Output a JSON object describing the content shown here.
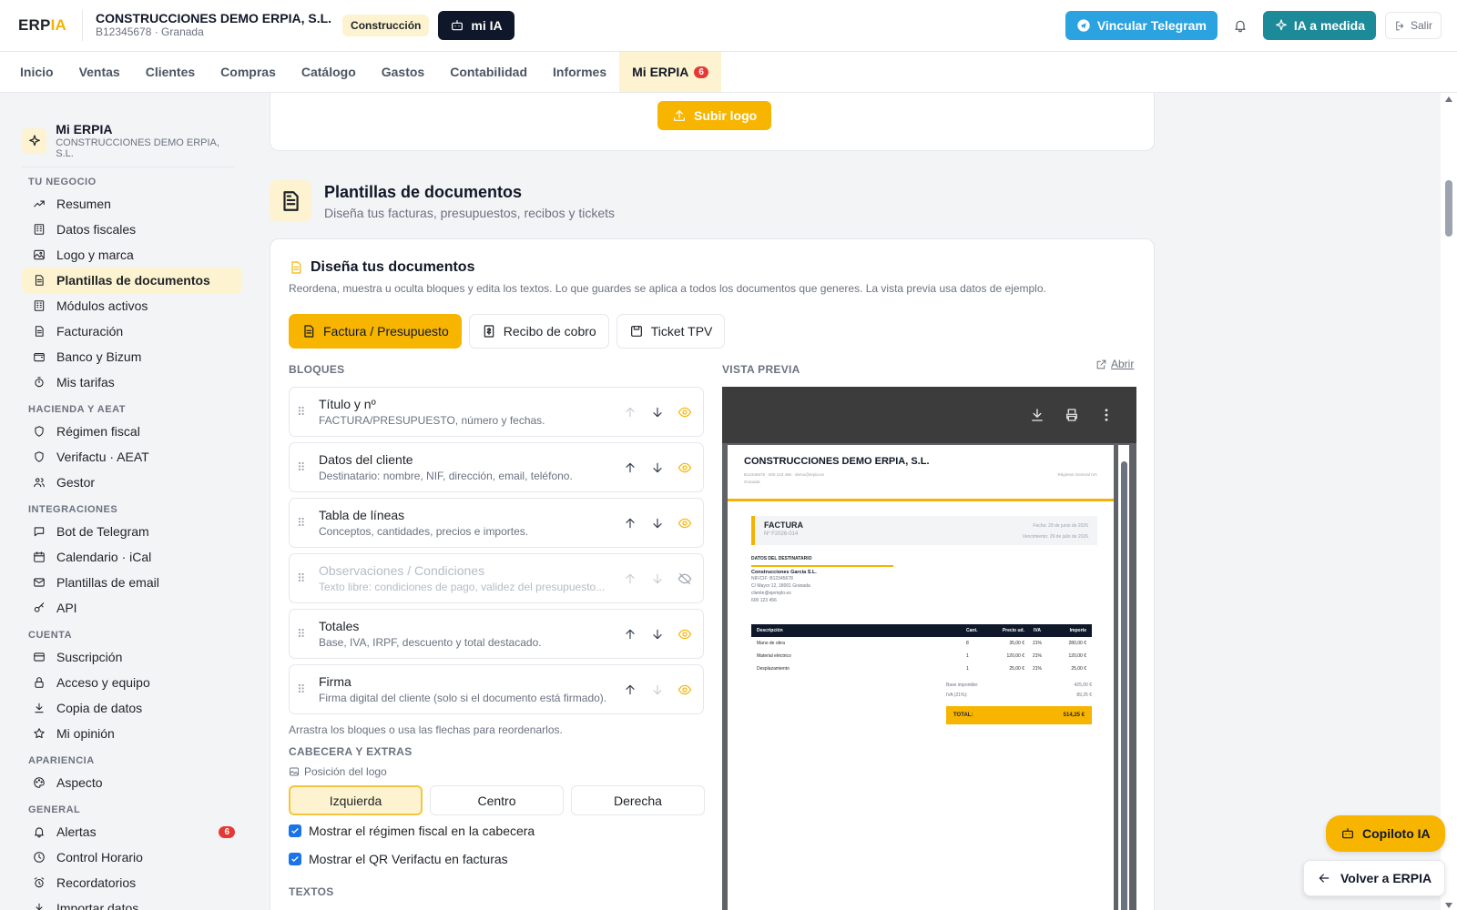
{
  "header": {
    "logo_a": "ERP",
    "logo_b": "IA",
    "company_name": "CONSTRUCCIONES DEMO ERPIA, S.L.",
    "company_sub": "B12345678 · Granada",
    "sector": "Construcción",
    "mi_ia": "mi IA",
    "telegram": "Vincular Telegram",
    "ia_medida": "IA a medida",
    "salir": "Salir"
  },
  "nav": {
    "tabs": [
      {
        "label": "Inicio"
      },
      {
        "label": "Ventas"
      },
      {
        "label": "Clientes"
      },
      {
        "label": "Compras"
      },
      {
        "label": "Catálogo"
      },
      {
        "label": "Gastos"
      },
      {
        "label": "Contabilidad"
      },
      {
        "label": "Informes"
      },
      {
        "label": "Mi ERPIA",
        "badge": "6",
        "active": true
      }
    ]
  },
  "sidebar": {
    "title": "Mi ERPIA",
    "subtitle": "CONSTRUCCIONES DEMO ERPIA, S.L.",
    "sections": [
      {
        "label": "TU NEGOCIO",
        "items": [
          {
            "label": "Resumen",
            "icon": "trend-icon"
          },
          {
            "label": "Datos fiscales",
            "icon": "building-icon"
          },
          {
            "label": "Logo y marca",
            "icon": "image-icon"
          },
          {
            "label": "Plantillas de documentos",
            "icon": "document-icon",
            "active": true
          },
          {
            "label": "Módulos activos",
            "icon": "building-icon"
          },
          {
            "label": "Facturación",
            "icon": "document-icon"
          },
          {
            "label": "Banco y Bizum",
            "icon": "wallet-icon"
          },
          {
            "label": "Mis tarifas",
            "icon": "timer-icon"
          }
        ]
      },
      {
        "label": "HACIENDA Y AEAT",
        "items": [
          {
            "label": "Régimen fiscal",
            "icon": "shield-icon"
          },
          {
            "label": "Verifactu · AEAT",
            "icon": "shield-icon"
          },
          {
            "label": "Gestor",
            "icon": "users-icon"
          }
        ]
      },
      {
        "label": "INTEGRACIONES",
        "items": [
          {
            "label": "Bot de Telegram",
            "icon": "chat-icon"
          },
          {
            "label": "Calendario · iCal",
            "icon": "calendar-icon"
          },
          {
            "label": "Plantillas de email",
            "icon": "mail-icon"
          },
          {
            "label": "API",
            "icon": "key-icon"
          }
        ]
      },
      {
        "label": "CUENTA",
        "items": [
          {
            "label": "Suscripción",
            "icon": "card-icon"
          },
          {
            "label": "Acceso y equipo",
            "icon": "lock-icon"
          },
          {
            "label": "Copia de datos",
            "icon": "download-icon"
          },
          {
            "label": "Mi opinión",
            "icon": "star-icon"
          }
        ]
      },
      {
        "label": "APARIENCIA",
        "items": [
          {
            "label": "Aspecto",
            "icon": "palette-icon"
          }
        ]
      },
      {
        "label": "GENERAL",
        "items": [
          {
            "label": "Alertas",
            "icon": "bell-icon",
            "badge": "6"
          },
          {
            "label": "Control Horario",
            "icon": "clock-icon"
          },
          {
            "label": "Recordatorios",
            "icon": "alarm-icon"
          },
          {
            "label": "Importar datos",
            "icon": "download-icon"
          }
        ]
      }
    ]
  },
  "upload": {
    "label": "Subir logo"
  },
  "section": {
    "title": "Plantillas de documentos",
    "subtitle": "Diseña tus facturas, presupuestos, recibos y tickets"
  },
  "design": {
    "title": "Diseña tus documentos",
    "desc": "Reordena, muestra u oculta bloques y edita los textos. Lo que guardes se aplica a todos los documentos que generes. La vista previa usa datos de ejemplo.",
    "tabs": [
      {
        "label": "Factura / Presupuesto",
        "active": true
      },
      {
        "label": "Recibo de cobro"
      },
      {
        "label": "Ticket TPV"
      }
    ],
    "blocks_label": "BLOQUES",
    "preview_label": "VISTA PREVIA",
    "open_label": "Abrir",
    "blocks": [
      {
        "title": "Título y nº",
        "sub": "FACTURA/PRESUPUESTO, número y fechas.",
        "visible": true
      },
      {
        "title": "Datos del cliente",
        "sub": "Destinatario: nombre, NIF, dirección, email, teléfono.",
        "visible": true
      },
      {
        "title": "Tabla de líneas",
        "sub": "Conceptos, cantidades, precios e importes.",
        "visible": true
      },
      {
        "title": "Observaciones / Condiciones",
        "sub": "Texto libre: condiciones de pago, validez del presupuesto...",
        "visible": false
      },
      {
        "title": "Totales",
        "sub": "Base, IVA, IRPF, descuento y total destacado.",
        "visible": true
      },
      {
        "title": "Firma",
        "sub": "Firma digital del cliente (solo si el documento está firmado).",
        "visible": true
      }
    ],
    "hint": "Arrastra los bloques o usa las flechas para reordenarlos.",
    "header_extras_label": "CABECERA Y EXTRAS",
    "logo_pos_label": "Posición del logo",
    "logo_pos": [
      "Izquierda",
      "Centro",
      "Derecha"
    ],
    "check1": "Mostrar el régimen fiscal en la cabecera",
    "check2": "Mostrar el QR Verifactu en facturas",
    "textos_label": "TEXTOS"
  },
  "preview_doc": {
    "company": "CONSTRUCCIONES DEMO ERPIA, S.L.",
    "contact": "B12345678 · 600 123 456 · demo@erpia.es",
    "city": "Granada",
    "regime": "Régimen General IVA",
    "doc_type": "FACTURA",
    "doc_num": "Nº F2026-014",
    "fecha": "Fecha: 29 de junio de 2026",
    "vencimiento": "Vencimiento: 29 de julio de 2026",
    "dest_title": "DATOS DEL DESTINATARIO",
    "dest_lines": [
      "Construcciones García S.L.",
      "NIF/CIF: B12345678",
      "C/ Mayor 12, 18001 Granada",
      "cliente@ejemplo.es",
      "600 123 456"
    ],
    "table_head": [
      "Descripción",
      "Cant.",
      "Precio ud.",
      "IVA",
      "Importe"
    ],
    "rows": [
      [
        "Mano de obra",
        "8",
        "35,00 €",
        "21%",
        "280,00 €"
      ],
      [
        "Material eléctrico",
        "1",
        "120,00 €",
        "21%",
        "120,00 €"
      ],
      [
        "Desplazamiento",
        "1",
        "25,00 €",
        "21%",
        "25,00 €"
      ]
    ],
    "base_label": "Base imponible:",
    "base": "425,00 €",
    "iva_label": "IVA (21%):",
    "iva": "89,25 €",
    "total_label": "TOTAL:",
    "total": "514,25 €"
  },
  "floating": {
    "copilot": "Copiloto IA",
    "volver": "Volver a ERPIA"
  },
  "colors": {
    "accent": "#f7b500",
    "accent_soft": "#fdf3d0",
    "telegram": "#2aa3e0",
    "ia": "#1d8a99",
    "badge": "#e53935"
  }
}
